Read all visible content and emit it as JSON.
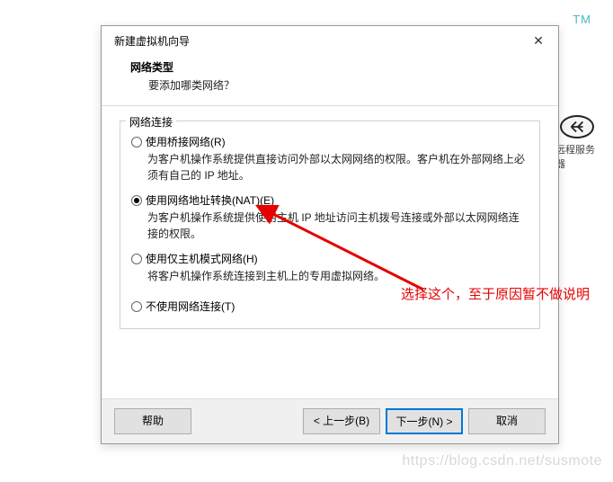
{
  "bg": {
    "tm": "TM",
    "remote_label": "远程服务器"
  },
  "dialog": {
    "title": "新建虚拟机向导",
    "header_title": "网络类型",
    "header_subtitle": "要添加哪类网络？",
    "group_label": "网络连接",
    "options": [
      {
        "label": "使用桥接网络(R)",
        "desc": "为客户机操作系统提供直接访问外部以太网网络的权限。客户机在外部网络上必须有自己的 IP 地址。",
        "checked": false
      },
      {
        "label": "使用网络地址转换(NAT)(E)",
        "desc": "为客户机操作系统提供使用主机 IP 地址访问主机拨号连接或外部以太网网络连接的权限。",
        "checked": true
      },
      {
        "label": "使用仅主机模式网络(H)",
        "desc": "将客户机操作系统连接到主机上的专用虚拟网络。",
        "checked": false
      },
      {
        "label": "不使用网络连接(T)",
        "desc": "",
        "checked": false
      }
    ],
    "buttons": {
      "help": "帮助",
      "back": "< 上一步(B)",
      "next": "下一步(N) >",
      "cancel": "取消"
    }
  },
  "annotation": "选择这个，至于原因暂不做说明",
  "watermark": "https://blog.csdn.net/susmote"
}
